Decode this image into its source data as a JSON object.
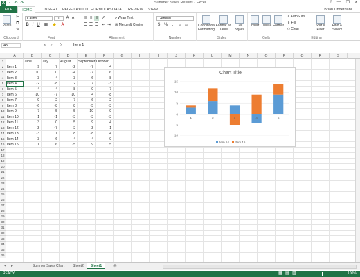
{
  "window": {
    "title": "Summer Sales Results - Excel",
    "user": "Brian Underdahl",
    "controls": [
      "?",
      "—",
      "❐",
      "✕"
    ]
  },
  "ribbon_tabs": [
    "FILE",
    "HOME",
    "INSERT",
    "PAGE LAYOUT",
    "FORMULAS",
    "DATA",
    "REVIEW",
    "VIEW"
  ],
  "ribbon": {
    "paste": "Paste",
    "font_name": "Calibri",
    "font_size": "11",
    "wrap_text": "Wrap Text",
    "merge_center": "Merge & Center",
    "number_format": "General",
    "conditional_formatting": "Conditional Formatting",
    "format_as_table": "Format as Table",
    "cell_styles": "Cell Styles",
    "insert": "Insert",
    "delete": "Delete",
    "format": "Format",
    "autosum": "AutoSum",
    "fill": "Fill",
    "clear": "Clear",
    "sort_filter": "Sort & Filter",
    "find_select": "Find & Select",
    "groups": [
      "Clipboard",
      "Font",
      "Alignment",
      "Number",
      "Styles",
      "Cells",
      "Editing"
    ]
  },
  "formula_bar": {
    "name_box": "A5",
    "fx": "fx",
    "content": "Item 1"
  },
  "columns": [
    "A",
    "B",
    "C",
    "D",
    "E",
    "F",
    "G",
    "H",
    "I",
    "J",
    "K",
    "L",
    "M",
    "N",
    "O",
    "P",
    "Q",
    "R",
    "S"
  ],
  "row_numbers": [
    "1",
    "2",
    "3",
    "4",
    "5",
    "6",
    "7",
    "8",
    "9",
    "10",
    "11",
    "12",
    "13",
    "14",
    "15",
    "16",
    "17",
    "18",
    "19",
    "20",
    "21",
    "22",
    "23",
    "24",
    "25",
    "26",
    "27",
    "28",
    "29",
    "30",
    "31",
    "32",
    "33",
    "34",
    "35",
    "36"
  ],
  "headers": [
    "June",
    "July",
    "August",
    "September",
    "October"
  ],
  "rows": [
    {
      "label": "Item 1",
      "values": [
        9,
        7,
        -2,
        -7,
        4
      ]
    },
    {
      "label": "Item 2",
      "values": [
        10,
        0,
        -4,
        -7,
        6
      ]
    },
    {
      "label": "Item 3",
      "values": [
        3,
        4,
        3,
        -6,
        8
      ]
    },
    {
      "label": "Item 4",
      "values": [
        -2,
        -8,
        2,
        7,
        -3
      ]
    },
    {
      "label": "Item 5",
      "values": [
        -4,
        -4,
        -8,
        0,
        7
      ]
    },
    {
      "label": "Item 6",
      "values": [
        -10,
        -7,
        -10,
        4,
        -8
      ]
    },
    {
      "label": "Item 7",
      "values": [
        9,
        2,
        -7,
        6,
        2
      ]
    },
    {
      "label": "Item 8",
      "values": [
        -6,
        -8,
        8,
        -5,
        -3
      ]
    },
    {
      "label": "Item 9",
      "values": [
        -7,
        5,
        -5,
        -10,
        -9
      ]
    },
    {
      "label": "Item 10",
      "values": [
        1,
        -1,
        -3,
        -3,
        -3
      ]
    },
    {
      "label": "Item 11",
      "values": [
        3,
        0,
        5,
        9,
        4
      ]
    },
    {
      "label": "Item 12",
      "values": [
        2,
        -7,
        3,
        2,
        1
      ]
    },
    {
      "label": "Item 13",
      "values": [
        -3,
        1,
        8,
        -8,
        4
      ]
    },
    {
      "label": "Item 14",
      "values": [
        3,
        6,
        4,
        -4,
        9
      ]
    },
    {
      "label": "Item 15",
      "values": [
        1,
        6,
        -5,
        9,
        5
      ]
    }
  ],
  "chart_data": {
    "type": "bar",
    "stacked": true,
    "title": "Chart Title",
    "categories": [
      "1",
      "2",
      "3",
      "4",
      "5"
    ],
    "series": [
      {
        "name": "Item 14",
        "values": [
          3,
          6,
          4,
          -4,
          9
        ],
        "color": "#5b9bd5"
      },
      {
        "name": "Item 15",
        "values": [
          1,
          6,
          -5,
          9,
          5
        ],
        "color": "#ed7d31"
      }
    ],
    "ylim": [
      -10,
      15
    ],
    "yticks": [
      "-10",
      "-5",
      "0",
      "5",
      "10",
      "15"
    ],
    "legend": "bottom",
    "grid": true
  },
  "sheet_tabs": [
    "Summer Sales Chart",
    "Sheet2",
    "Sheet1"
  ],
  "active_sheet": "Sheet1",
  "status": {
    "ready": "READY",
    "zoom": "100%"
  },
  "colors": {
    "accent": "#217346",
    "series1": "#5b9bd5",
    "series2": "#ed7d31"
  }
}
